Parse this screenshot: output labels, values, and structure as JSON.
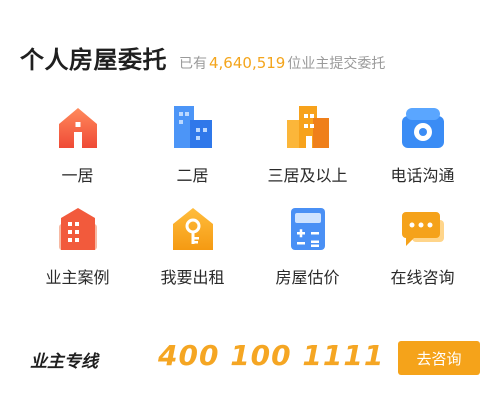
{
  "header": {
    "title": "个人房屋委托",
    "count_prefix": "已有",
    "count_value": "4,640,519",
    "count_suffix": "位业主提交委托"
  },
  "grid": [
    {
      "label": "一居",
      "icon": "house-icon"
    },
    {
      "label": "二居",
      "icon": "building-icon"
    },
    {
      "label": "三居及以上",
      "icon": "tall-building-icon"
    },
    {
      "label": "电话沟通",
      "icon": "telephone-icon"
    },
    {
      "label": "业主案例",
      "icon": "document-icon"
    },
    {
      "label": "我要出租",
      "icon": "key-house-icon"
    },
    {
      "label": "房屋估价",
      "icon": "calculator-icon"
    },
    {
      "label": "在线咨询",
      "icon": "chat-bubble-icon"
    }
  ],
  "hotline": {
    "label": "业主专线",
    "phone": "400 100 1111",
    "button_label": "去咨询"
  },
  "colors": {
    "accent": "#f5a623",
    "red": "#f25a3c",
    "blue": "#3f8cf5"
  }
}
